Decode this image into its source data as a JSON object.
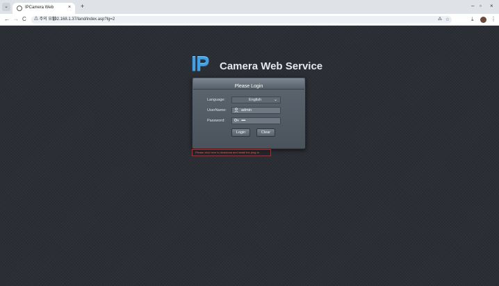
{
  "browser": {
    "tab_list_icon": "⌄",
    "tab_title": "IPCamera Web",
    "tab_close": "×",
    "new_tab": "+",
    "window_controls": {
      "minimize": "–",
      "maximize": "▫",
      "close": "×"
    },
    "nav": {
      "back": "←",
      "forward": "→",
      "reload": "C"
    },
    "security_chip": "⚠ 주의 요함",
    "url": "192.168.1.37/land/index.asp?lg=2",
    "omnibox_icons": {
      "translate": "⁂",
      "bookmark": "☆"
    },
    "toolbar_icons": {
      "download": "⤓",
      "menu": "⋮"
    }
  },
  "logo": {
    "ip": "IP",
    "text": "Camera Web Service",
    "accent_color": "#3fa0e8"
  },
  "login_panel": {
    "title": "Please Login",
    "language": {
      "label": "Language:",
      "value": "English",
      "caret": "⌄"
    },
    "username": {
      "label": "UserName:",
      "icon": "user-icon",
      "value": "admin"
    },
    "password": {
      "label": "Password:",
      "icon": "key-icon",
      "masked_value": "••••••"
    },
    "buttons": {
      "login": "Login",
      "clear": "Clear"
    }
  },
  "plugin_notice": {
    "text": "Please click here to download and install the plug-in",
    "border_color": "#d21e1e"
  }
}
